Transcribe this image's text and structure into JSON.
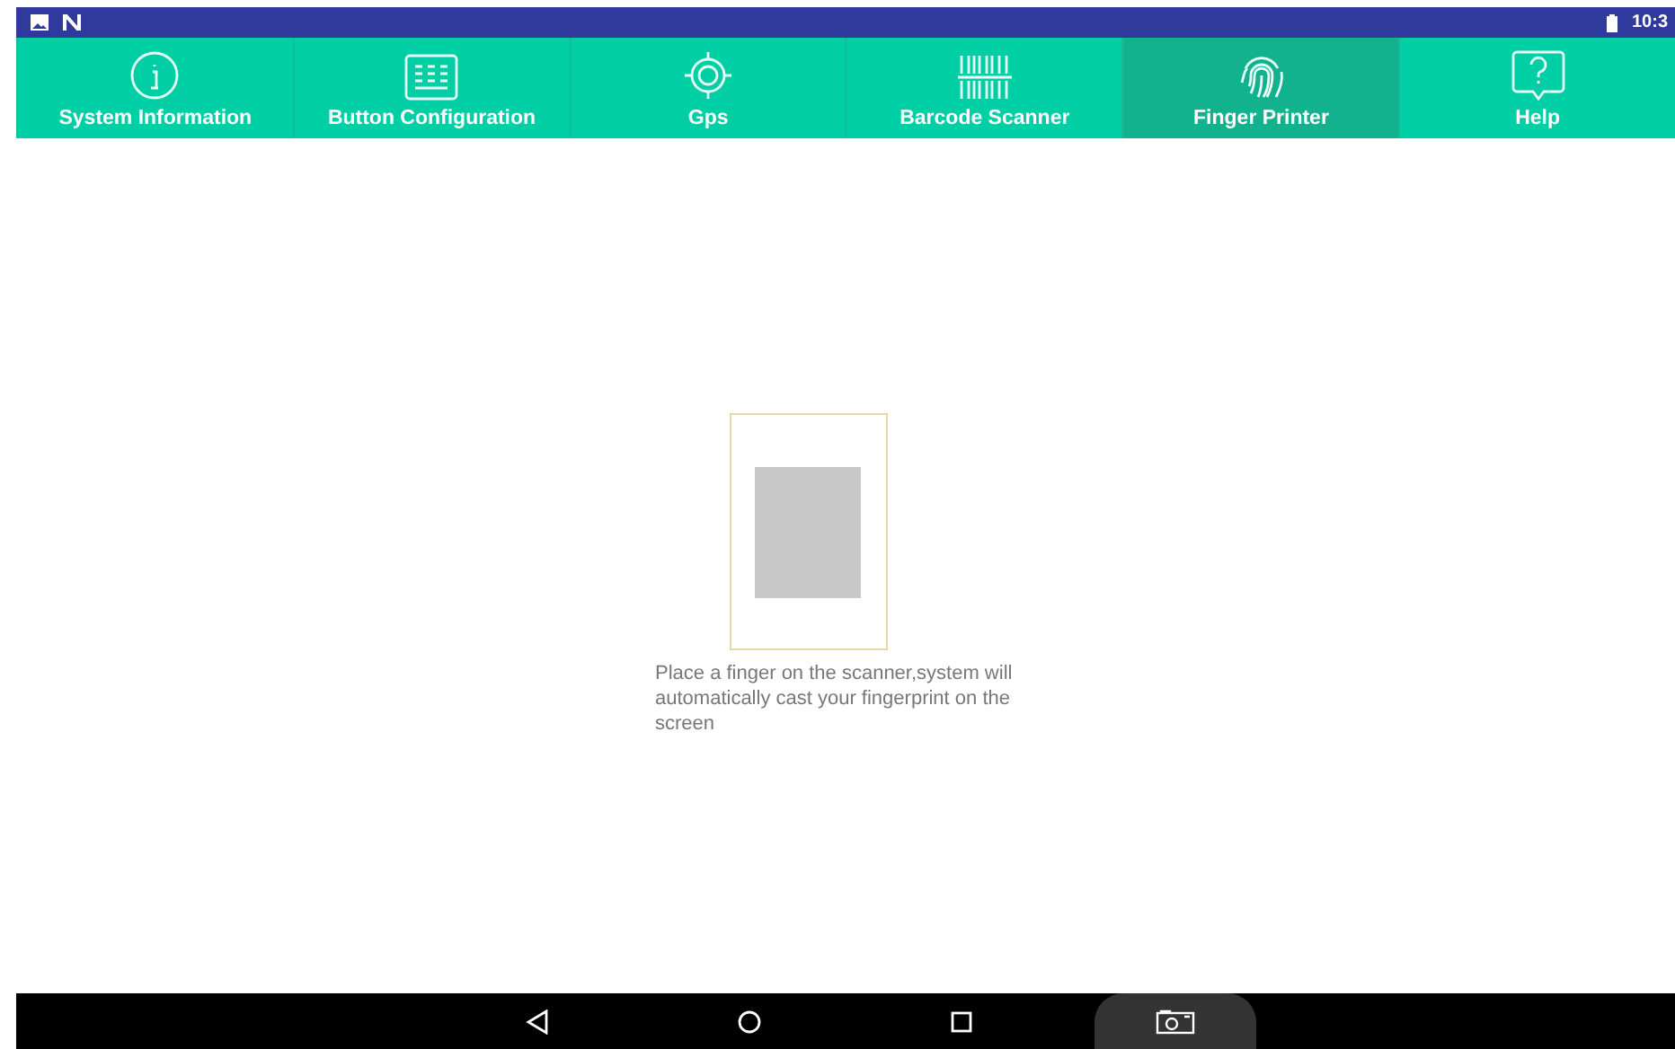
{
  "status_bar": {
    "time": "10:3"
  },
  "tabs": [
    {
      "label": "System Information",
      "kind": "info",
      "selected": false
    },
    {
      "label": "Button Configuration",
      "kind": "keyboard",
      "selected": false
    },
    {
      "label": "Gps",
      "kind": "gps",
      "selected": false
    },
    {
      "label": "Barcode Scanner",
      "kind": "barcode",
      "selected": false
    },
    {
      "label": "Finger Printer",
      "kind": "fingerprint",
      "selected": true
    },
    {
      "label": "Help",
      "kind": "help",
      "selected": false
    }
  ],
  "scanner": {
    "instruction": "Place a finger on the scanner,system will automatically cast your fingerprint on the screen"
  }
}
